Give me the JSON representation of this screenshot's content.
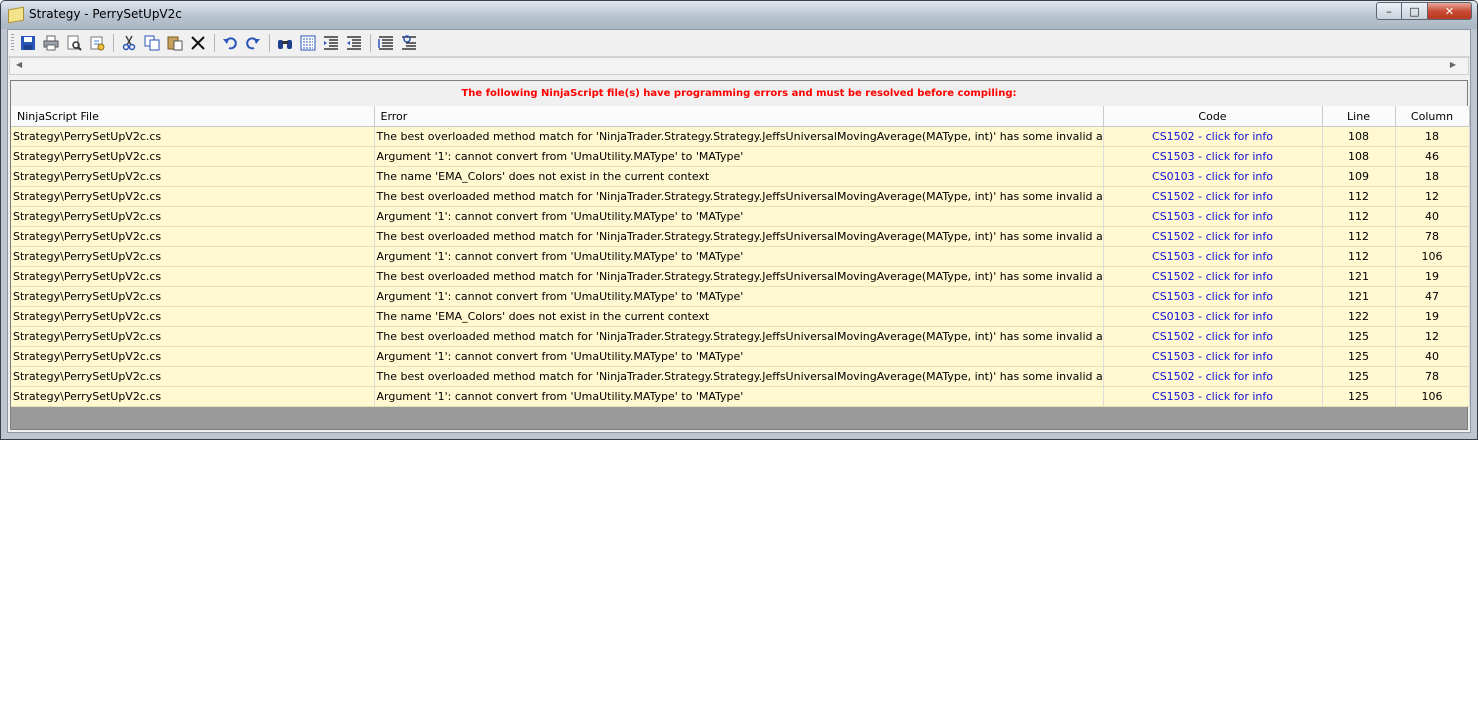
{
  "window": {
    "title": "Strategy - PerrySetUpV2c",
    "min_label": "–",
    "max_label": "□",
    "close_label": "✕"
  },
  "toolbar": {
    "icons": [
      "save-icon",
      "print-icon",
      "print-preview-icon",
      "page-setup-icon",
      "cut-icon",
      "copy-icon",
      "paste-icon",
      "delete-icon",
      "undo-icon",
      "redo-icon",
      "find-icon",
      "find-replace-icon",
      "indent-icon",
      "outdent-icon",
      "comment-icon",
      "uncomment-icon"
    ]
  },
  "errors": {
    "message": "The following NinjaScript file(s) have programming errors and must be resolved before compiling:",
    "columns": [
      "NinjaScript File",
      "Error",
      "Code",
      "Line",
      "Column"
    ],
    "rows": [
      {
        "file": "Strategy\\PerrySetUpV2c.cs",
        "error": "The best overloaded method match for 'NinjaTrader.Strategy.Strategy.JeffsUniversalMovingAverage(MAType, int)' has some invalid arguments",
        "code": "CS1502 - click for info",
        "line": "108",
        "column": "18"
      },
      {
        "file": "Strategy\\PerrySetUpV2c.cs",
        "error": "Argument '1': cannot convert from 'UmaUtility.MAType' to 'MAType'",
        "code": "CS1503 - click for info",
        "line": "108",
        "column": "46"
      },
      {
        "file": "Strategy\\PerrySetUpV2c.cs",
        "error": "The name 'EMA_Colors' does not exist in the current context",
        "code": "CS0103 - click for info",
        "line": "109",
        "column": "18"
      },
      {
        "file": "Strategy\\PerrySetUpV2c.cs",
        "error": "The best overloaded method match for 'NinjaTrader.Strategy.Strategy.JeffsUniversalMovingAverage(MAType, int)' has some invalid arguments",
        "code": "CS1502 - click for info",
        "line": "112",
        "column": "12"
      },
      {
        "file": "Strategy\\PerrySetUpV2c.cs",
        "error": "Argument '1': cannot convert from 'UmaUtility.MAType' to 'MAType'",
        "code": "CS1503 - click for info",
        "line": "112",
        "column": "40"
      },
      {
        "file": "Strategy\\PerrySetUpV2c.cs",
        "error": "The best overloaded method match for 'NinjaTrader.Strategy.Strategy.JeffsUniversalMovingAverage(MAType, int)' has some invalid arguments",
        "code": "CS1502 - click for info",
        "line": "112",
        "column": "78"
      },
      {
        "file": "Strategy\\PerrySetUpV2c.cs",
        "error": "Argument '1': cannot convert from 'UmaUtility.MAType' to 'MAType'",
        "code": "CS1503 - click for info",
        "line": "112",
        "column": "106"
      },
      {
        "file": "Strategy\\PerrySetUpV2c.cs",
        "error": "The best overloaded method match for 'NinjaTrader.Strategy.Strategy.JeffsUniversalMovingAverage(MAType, int)' has some invalid arguments",
        "code": "CS1502 - click for info",
        "line": "121",
        "column": "19"
      },
      {
        "file": "Strategy\\PerrySetUpV2c.cs",
        "error": "Argument '1': cannot convert from 'UmaUtility.MAType' to 'MAType'",
        "code": "CS1503 - click for info",
        "line": "121",
        "column": "47"
      },
      {
        "file": "Strategy\\PerrySetUpV2c.cs",
        "error": "The name 'EMA_Colors' does not exist in the current context",
        "code": "CS0103 - click for info",
        "line": "122",
        "column": "19"
      },
      {
        "file": "Strategy\\PerrySetUpV2c.cs",
        "error": "The best overloaded method match for 'NinjaTrader.Strategy.Strategy.JeffsUniversalMovingAverage(MAType, int)' has some invalid arguments",
        "code": "CS1502 - click for info",
        "line": "125",
        "column": "12"
      },
      {
        "file": "Strategy\\PerrySetUpV2c.cs",
        "error": "Argument '1': cannot convert from 'UmaUtility.MAType' to 'MAType'",
        "code": "CS1503 - click for info",
        "line": "125",
        "column": "40"
      },
      {
        "file": "Strategy\\PerrySetUpV2c.cs",
        "error": "The best overloaded method match for 'NinjaTrader.Strategy.Strategy.JeffsUniversalMovingAverage(MAType, int)' has some invalid arguments",
        "code": "CS1502 - click for info",
        "line": "125",
        "column": "78"
      },
      {
        "file": "Strategy\\PerrySetUpV2c.cs",
        "error": "Argument '1': cannot convert from 'UmaUtility.MAType' to 'MAType'",
        "code": "CS1503 - click for info",
        "line": "125",
        "column": "106"
      }
    ]
  },
  "colors": {
    "error_text": "#ff0000",
    "row_background": "#fff8d0",
    "link_text": "#1010d8"
  }
}
